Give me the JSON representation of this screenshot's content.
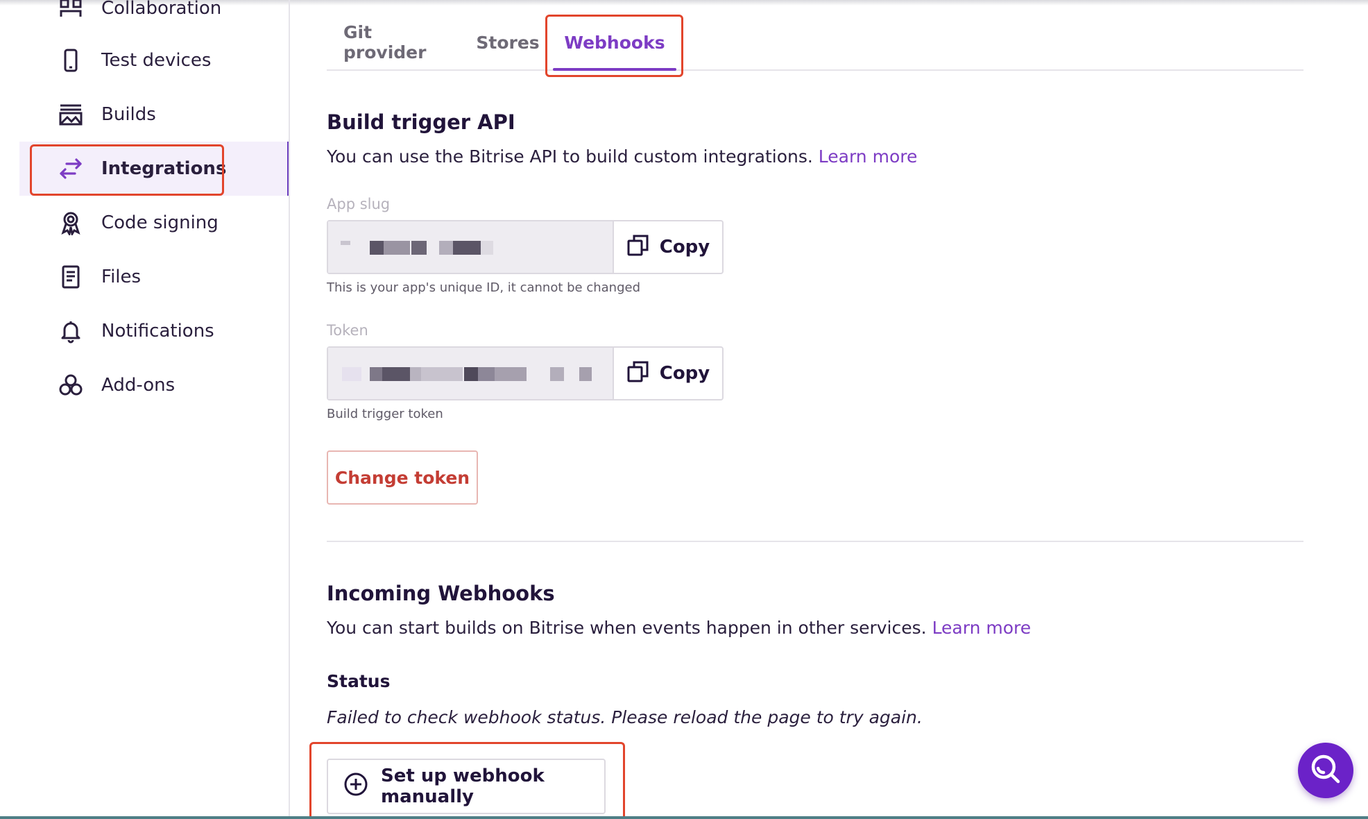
{
  "sidebar": {
    "items": [
      {
        "label": "Collaboration",
        "icon": "collaboration-icon"
      },
      {
        "label": "Test devices",
        "icon": "phone-icon"
      },
      {
        "label": "Builds",
        "icon": "builds-icon"
      },
      {
        "label": "Integrations",
        "icon": "arrows-exchange-icon",
        "active": true
      },
      {
        "label": "Code signing",
        "icon": "badge-icon"
      },
      {
        "label": "Files",
        "icon": "file-icon"
      },
      {
        "label": "Notifications",
        "icon": "bell-icon"
      },
      {
        "label": "Add-ons",
        "icon": "addons-icon"
      }
    ]
  },
  "tabs": [
    {
      "label": "Git provider"
    },
    {
      "label": "Stores"
    },
    {
      "label": "Webhooks",
      "active": true
    }
  ],
  "build_trigger": {
    "title": "Build trigger API",
    "description": "You can use the Bitrise API to build custom integrations.",
    "learn_more": "Learn more",
    "app_slug": {
      "label": "App slug",
      "copy_label": "Copy",
      "hint": "This is your app's unique ID, it cannot be changed"
    },
    "token": {
      "label": "Token",
      "copy_label": "Copy",
      "hint": "Build trigger token"
    },
    "change_token_label": "Change token"
  },
  "incoming_webhooks": {
    "title": "Incoming Webhooks",
    "description": "You can start builds on Bitrise when events happen in other services.",
    "learn_more": "Learn more",
    "status_label": "Status",
    "status_text": "Failed to check webhook status. Please reload the page to try again.",
    "setup_button_label": "Set up webhook manually"
  },
  "colors": {
    "accent": "#7d3cc4",
    "highlight": "#e2452c",
    "danger": "#c43d34",
    "fab": "#6b22c8"
  }
}
